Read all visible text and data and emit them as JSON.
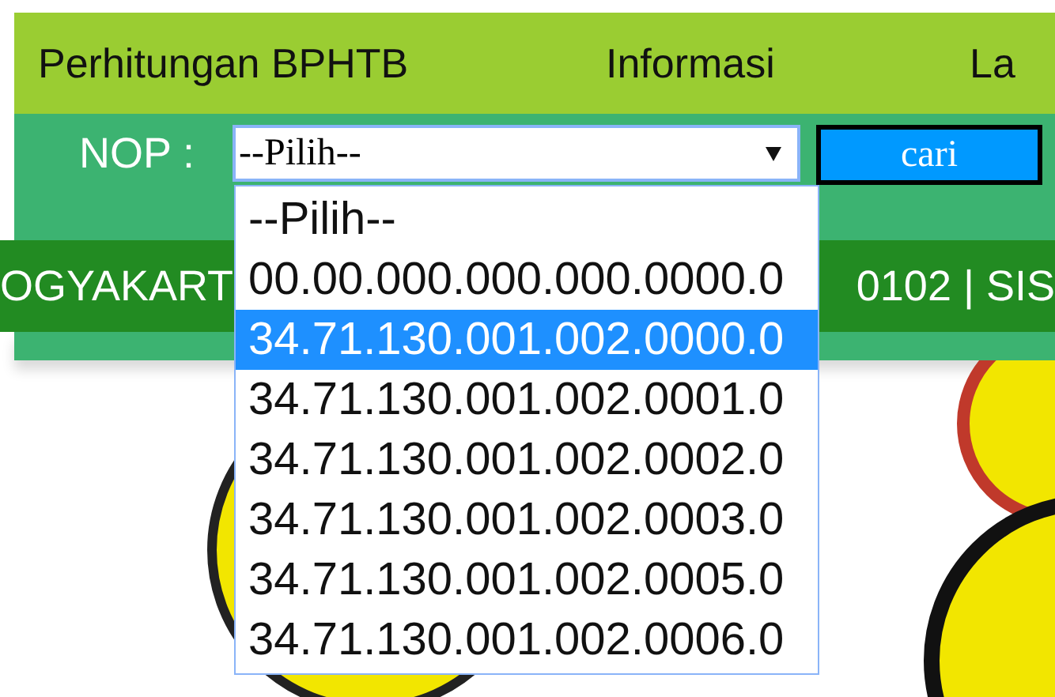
{
  "menu": [
    {
      "label": "Perhitungan BPHTB"
    },
    {
      "label": "Informasi"
    },
    {
      "label": "La"
    }
  ],
  "search": {
    "label": "NOP :",
    "select_value": "--Pilih--",
    "button": "cari"
  },
  "banner": {
    "left": "OGYAKART",
    "right": "0102 | SIS"
  },
  "dropdown": {
    "options": [
      {
        "label": "--Pilih--",
        "selected": false
      },
      {
        "label": "00.00.000.000.000.0000.0",
        "selected": false
      },
      {
        "label": "34.71.130.001.002.0000.0",
        "selected": true
      },
      {
        "label": "34.71.130.001.002.0001.0",
        "selected": false
      },
      {
        "label": "34.71.130.001.002.0002.0",
        "selected": false
      },
      {
        "label": "34.71.130.001.002.0003.0",
        "selected": false
      },
      {
        "label": "34.71.130.001.002.0005.0",
        "selected": false
      },
      {
        "label": "34.71.130.001.002.0006.0",
        "selected": false
      }
    ]
  }
}
